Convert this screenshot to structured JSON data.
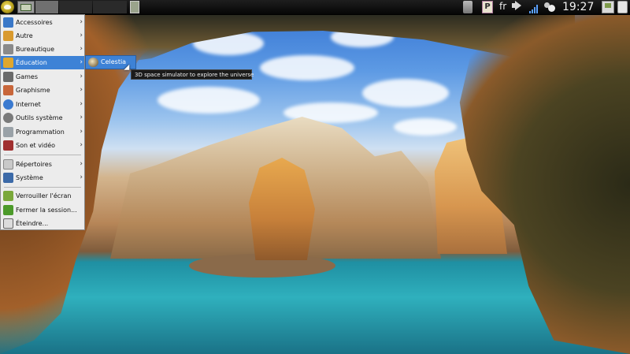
{
  "panel": {
    "language": "fr",
    "clock": "19:27",
    "tray_p_label": "P",
    "launchers": [
      "start-menu-icon",
      "file-manager-icon",
      "folder-icon"
    ],
    "tray_icons": [
      "trash-icon",
      "p-app-icon",
      "volume-icon",
      "network-signal-icon",
      "users-icon",
      "monitor-icon",
      "phone-icon"
    ]
  },
  "menu": {
    "items": [
      {
        "label": "Accessoires",
        "icon": "accessories-icon",
        "color": "#3a78c8",
        "has_submenu": true
      },
      {
        "label": "Autre",
        "icon": "other-icon",
        "color": "#d99a2e",
        "has_submenu": true
      },
      {
        "label": "Bureautique",
        "icon": "office-icon",
        "color": "#8a8a8a",
        "has_submenu": true
      },
      {
        "label": "Éducation",
        "icon": "education-icon",
        "color": "#e0a72e",
        "has_submenu": true,
        "selected": true
      },
      {
        "label": "Games",
        "icon": "games-icon",
        "color": "#6a6a6a",
        "has_submenu": true
      },
      {
        "label": "Graphisme",
        "icon": "graphics-icon",
        "color": "#c8663a",
        "has_submenu": true
      },
      {
        "label": "Internet",
        "icon": "internet-icon",
        "color": "#3a7ad0",
        "has_submenu": true
      },
      {
        "label": "Outils système",
        "icon": "system-tools-icon",
        "color": "#7a7a7a",
        "has_submenu": true
      },
      {
        "label": "Programmation",
        "icon": "programming-icon",
        "color": "#9aa2a8",
        "has_submenu": true
      },
      {
        "label": "Son et vidéo",
        "icon": "sound-video-icon",
        "color": "#a03030",
        "has_submenu": true
      },
      {
        "label": "Répertoires",
        "icon": "directories-icon",
        "color": "#c9c9c9",
        "has_submenu": true
      },
      {
        "label": "Système",
        "icon": "system-icon",
        "color": "#3c6aa8",
        "has_submenu": true
      },
      {
        "label": "Verrouiller l'écran",
        "icon": "lock-screen-icon",
        "color": "#7aa83a",
        "has_submenu": false
      },
      {
        "label": "Fermer la session...",
        "icon": "logout-icon",
        "color": "#4c9a2a",
        "has_submenu": false
      },
      {
        "label": "Éteindre...",
        "icon": "shutdown-icon",
        "color": "#dcdcdc",
        "has_submenu": false
      }
    ],
    "arrow_glyph": "›"
  },
  "submenu": {
    "item_label": "Celestia",
    "icon": "celestia-icon",
    "tooltip": "3D space simulator to explore the universe"
  },
  "colors": {
    "selection": "#3d82d6",
    "menu_bg": "#ececec",
    "panel_bg": "#0e0e0e"
  }
}
